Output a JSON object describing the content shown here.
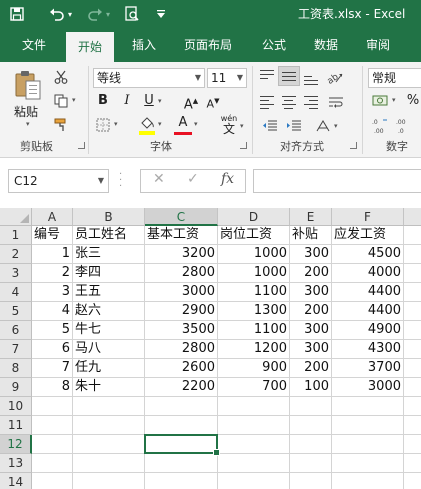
{
  "app": {
    "title": "工资表.xlsx  -  Excel"
  },
  "quick_access": {
    "save": "save-icon",
    "undo": "undo-icon",
    "redo": "redo-icon",
    "preview": "print-preview-icon",
    "customize": "customize-icon"
  },
  "tabs": [
    "文件",
    "开始",
    "插入",
    "页面布局",
    "公式",
    "数据",
    "审阅"
  ],
  "active_tab": "开始",
  "ribbon": {
    "clipboard": {
      "paste_label": "粘贴",
      "group_label": "剪贴板"
    },
    "font": {
      "font_name": "等线",
      "font_size": "11",
      "bold": "B",
      "italic": "I",
      "underline": "U",
      "grow": "A",
      "shrink": "A",
      "font_color": "A",
      "wen": "wén",
      "wen2": "文",
      "group_label": "字体"
    },
    "alignment": {
      "group_label": "对齐方式"
    },
    "number": {
      "format": "常规",
      "percent": "%",
      "group_label": "数字"
    }
  },
  "formula_bar": {
    "name_box": "C12",
    "cancel": "✕",
    "enter": "✓",
    "fx": "fx",
    "content": ""
  },
  "columns": [
    "A",
    "B",
    "C",
    "D",
    "E",
    "F"
  ],
  "rows": [
    "1",
    "2",
    "3",
    "4",
    "5",
    "6",
    "7",
    "8",
    "9",
    "10",
    "11",
    "12",
    "13",
    "14"
  ],
  "sheet": {
    "headers": [
      "编号",
      "员工姓名",
      "基本工资",
      "岗位工资",
      "补贴",
      "应发工资"
    ],
    "data": [
      [
        "1",
        "张三",
        "3200",
        "1000",
        "300",
        "4500"
      ],
      [
        "2",
        "李四",
        "2800",
        "1000",
        "200",
        "4000"
      ],
      [
        "3",
        "王五",
        "3000",
        "1100",
        "300",
        "4400"
      ],
      [
        "4",
        "赵六",
        "2900",
        "1300",
        "200",
        "4400"
      ],
      [
        "5",
        "牛七",
        "3500",
        "1100",
        "300",
        "4900"
      ],
      [
        "6",
        "马八",
        "2800",
        "1200",
        "300",
        "4300"
      ],
      [
        "7",
        "任九",
        "2600",
        "900",
        "200",
        "3700"
      ],
      [
        "8",
        "朱十",
        "2200",
        "700",
        "100",
        "3000"
      ]
    ]
  },
  "selection": {
    "cell": "C12",
    "column": "C",
    "row": "12"
  },
  "colors": {
    "accent": "#217346",
    "ribbon_bg": "#f3f3f3",
    "header_bg": "#e6e6e6",
    "font_color_bar": "#e81123",
    "highlight_bar": "#ffff00"
  }
}
